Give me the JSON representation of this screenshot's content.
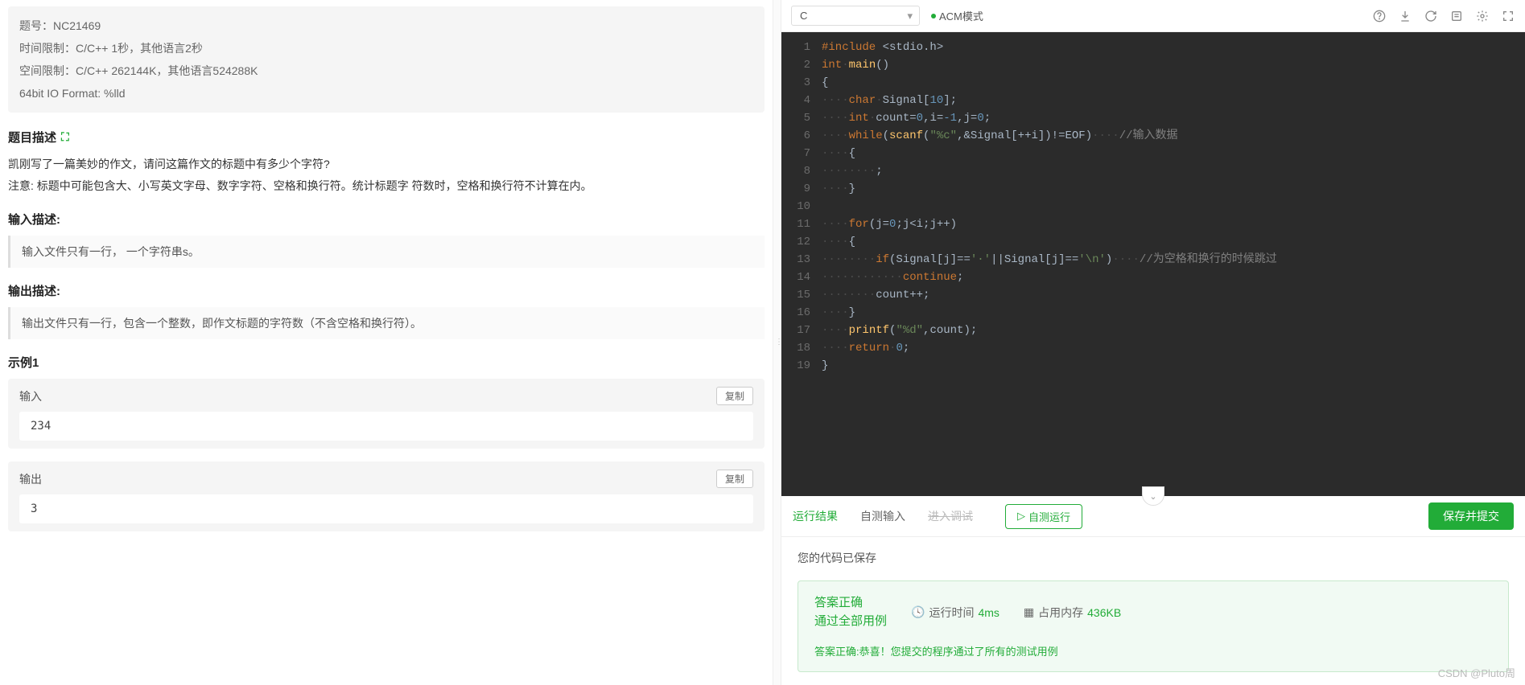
{
  "problem": {
    "meta": {
      "id_label": "题号：NC21469",
      "time_limit": "时间限制：C/C++ 1秒，其他语言2秒",
      "space_limit": "空间限制：C/C++ 262144K，其他语言524288K",
      "io_format": "64bit IO Format: %lld"
    },
    "desc_title": "题目描述",
    "desc_body": "凯刚写了一篇美妙的作文，请问这篇作文的标题中有多少个字符?\n注意: 标题中可能包含大、小写英文字母、数字字符、空格和换行符。统计标题字 符数时，空格和换行符不计算在内。",
    "input_title": "输入描述:",
    "input_body": "输入文件只有一行， 一个字符串s。",
    "output_title": "输出描述:",
    "output_body": "输出文件只有一行，包含一个整数，即作文标题的字符数（不含空格和换行符）。",
    "example_title": "示例1",
    "example_input_label": "输入",
    "example_input": "234",
    "example_output_label": "输出",
    "example_output": "3",
    "copy_label": "复制"
  },
  "editor": {
    "language": "C",
    "mode": "ACM模式"
  },
  "code_lines": [
    {
      "n": 1,
      "html": "<span class='kw'>#include</span> &lt;stdio.h&gt;"
    },
    {
      "n": 2,
      "html": "<span class='kw'>int</span><span class='dot'>·</span><span class='fn'>main</span>()"
    },
    {
      "n": 3,
      "html": "{"
    },
    {
      "n": 4,
      "html": "<span class='dot'>····</span><span class='kw'>char</span><span class='dot'>·</span>Signal[<span class='num'>10</span>];"
    },
    {
      "n": 5,
      "html": "<span class='dot'>····</span><span class='kw'>int</span><span class='dot'>·</span>count=<span class='num'>0</span>,i=<span class='num'>-1</span>,j=<span class='num'>0</span>;"
    },
    {
      "n": 6,
      "html": "<span class='dot'>····</span><span class='kw'>while</span>(<span class='fn'>scanf</span>(<span class='str'>\"%c\"</span>,&amp;Signal[++i])!=EOF)<span class='dot'>····</span><span class='comment'>//输入数据</span>"
    },
    {
      "n": 7,
      "html": "<span class='dot'>····</span>{"
    },
    {
      "n": 8,
      "html": "<span class='dot'>········</span>;"
    },
    {
      "n": 9,
      "html": "<span class='dot'>····</span>}"
    },
    {
      "n": 10,
      "html": ""
    },
    {
      "n": 11,
      "html": "<span class='dot'>····</span><span class='kw'>for</span>(j=<span class='num'>0</span>;j&lt;i;j++)"
    },
    {
      "n": 12,
      "html": "<span class='dot'>····</span>{"
    },
    {
      "n": 13,
      "html": "<span class='dot'>········</span><span class='kw'>if</span>(Signal[j]==<span class='str'>'·'</span>||Signal[j]==<span class='str'>'\\n'</span>)<span class='dot'>····</span><span class='comment'>//为空格和换行的时候跳过</span>"
    },
    {
      "n": 14,
      "html": "<span class='dot'>············</span><span class='kw'>continue</span>;"
    },
    {
      "n": 15,
      "html": "<span class='dot'>········</span>count++;"
    },
    {
      "n": 16,
      "html": "<span class='dot'>····</span>}"
    },
    {
      "n": 17,
      "html": "<span class='dot'>····</span><span class='fn'>printf</span>(<span class='str'>\"%d\"</span>,count);"
    },
    {
      "n": 18,
      "html": "<span class='dot'>····</span><span class='kw'>return</span><span class='dot'>·</span><span class='num'>0</span>;"
    },
    {
      "n": 19,
      "html": "}"
    }
  ],
  "tabs": {
    "result": "运行结果",
    "self_input": "自测输入",
    "debug": "进入调试",
    "self_run": "自测运行",
    "submit": "保存并提交"
  },
  "result": {
    "saved": "您的代码已保存",
    "status1": "答案正确",
    "status2": "通过全部用例",
    "time_label": "运行时间",
    "time_value": "4ms",
    "mem_label": "占用内存",
    "mem_value": "436KB",
    "message": "答案正确:恭喜！您提交的程序通过了所有的测试用例"
  },
  "watermark": "CSDN @Pluto周"
}
